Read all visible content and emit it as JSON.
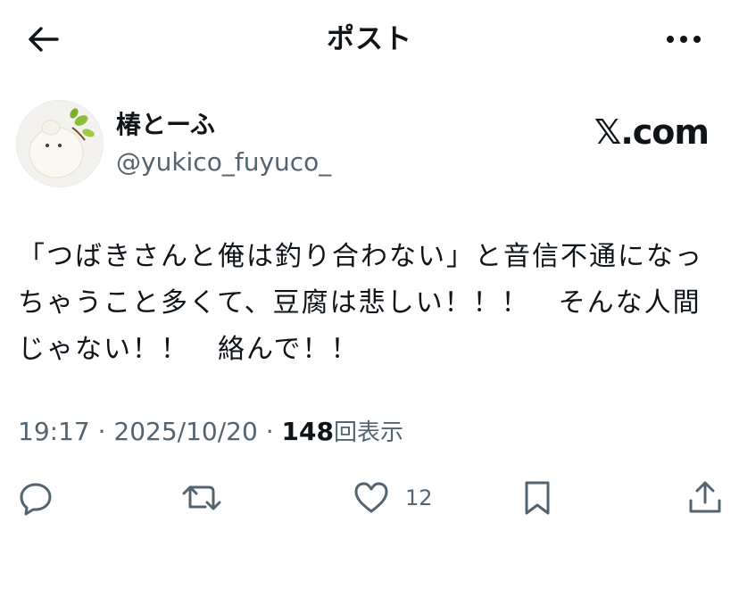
{
  "header": {
    "title": "ポスト"
  },
  "author": {
    "display_name": "椿とーふ",
    "handle": "@yukico_fuyuco_",
    "site_mark": "𝕏.com"
  },
  "post": {
    "text": "「つばきさんと俺は釣り合わない」と音信不通になっちゃうこと多くて、豆腐は悲しい！！！　そんな人間じゃない！！　絡んで！！"
  },
  "meta": {
    "time": "19:17",
    "separator": "·",
    "date": "2025/10/20",
    "separator2": "·",
    "views": "148",
    "views_label": "回表示"
  },
  "actions": {
    "like_count": "12"
  },
  "colors": {
    "text": "#0f1419",
    "secondary": "#536471"
  }
}
